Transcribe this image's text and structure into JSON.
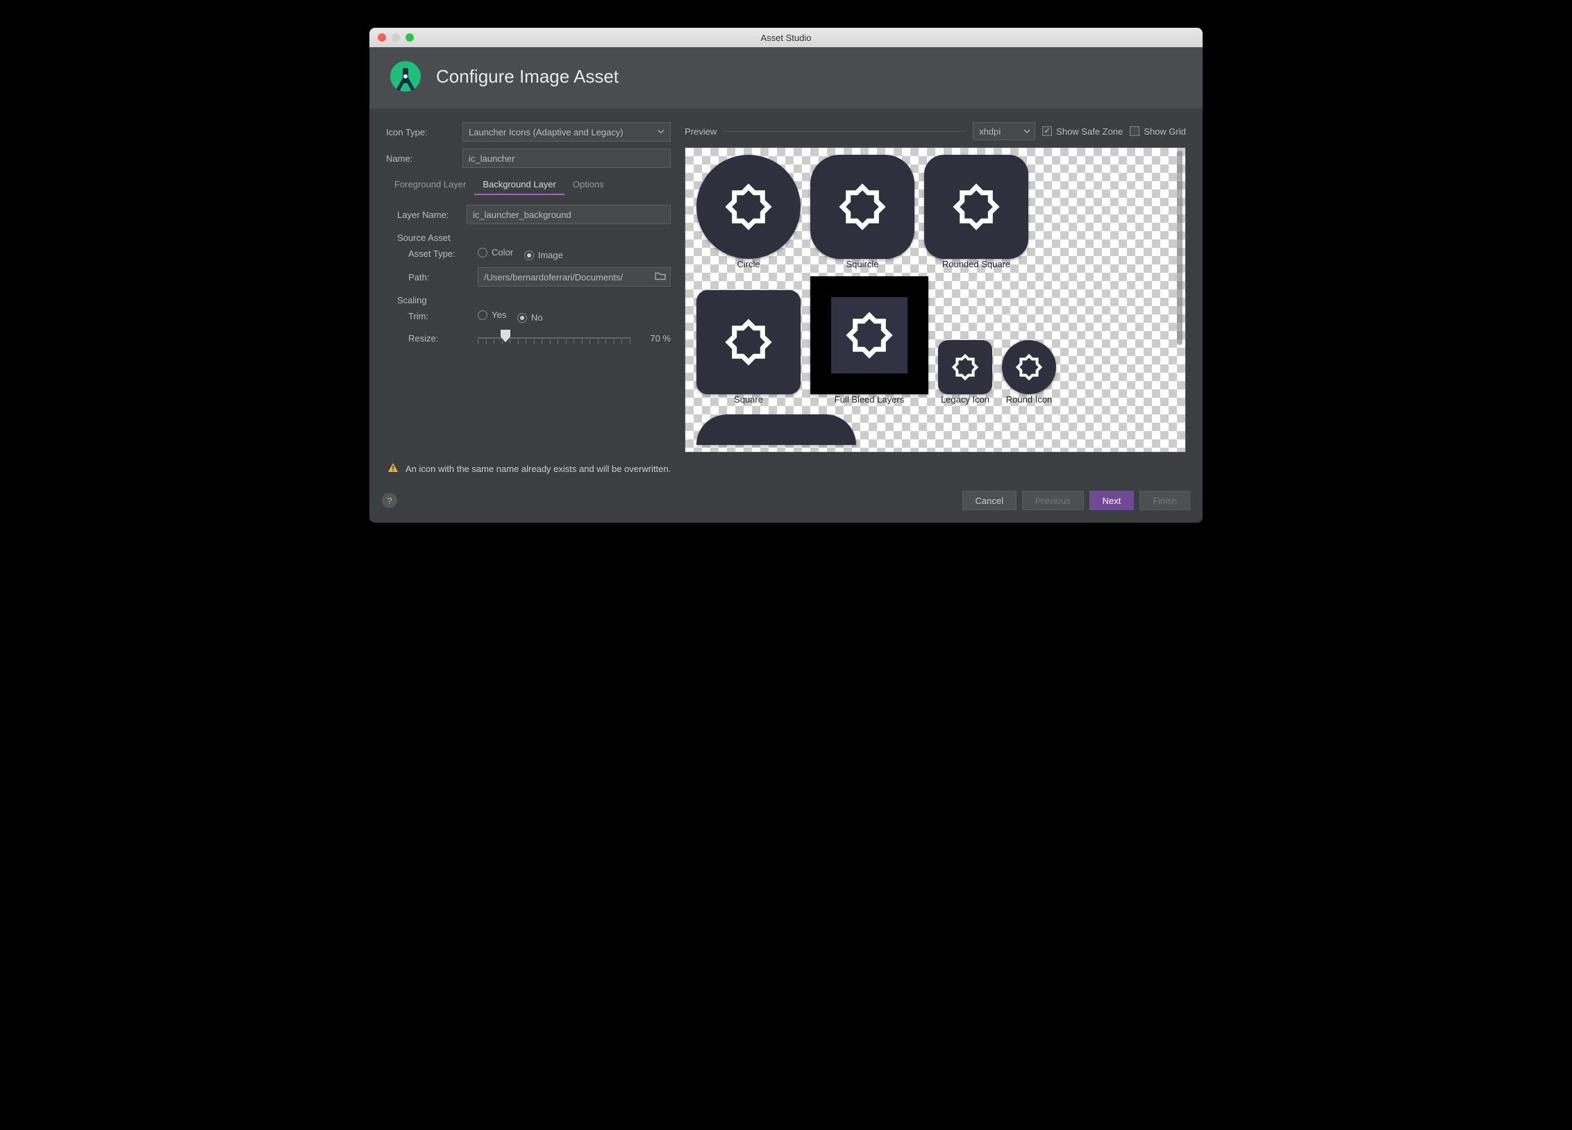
{
  "window": {
    "title": "Asset Studio"
  },
  "header": {
    "title": "Configure Image Asset"
  },
  "form": {
    "icon_type_label": "Icon Type:",
    "icon_type_value": "Launcher Icons (Adaptive and Legacy)",
    "name_label": "Name:",
    "name_value": "ic_launcher",
    "tabs": {
      "foreground": "Foreground Layer",
      "background": "Background Layer",
      "options": "Options"
    },
    "layer_name_label": "Layer Name:",
    "layer_name_value": "ic_launcher_background",
    "source_asset_label": "Source Asset",
    "asset_type_label": "Asset Type:",
    "asset_type_options": {
      "color": "Color",
      "image": "Image"
    },
    "path_label": "Path:",
    "path_value": "/Users/bernardoferrari/Documents/",
    "scaling_label": "Scaling",
    "trim_label": "Trim:",
    "trim_options": {
      "yes": "Yes",
      "no": "No"
    },
    "resize_label": "Resize:",
    "resize_value": "70 %"
  },
  "preview": {
    "label": "Preview",
    "density": "xhdpi",
    "show_safe_zone": "Show Safe Zone",
    "show_grid": "Show Grid",
    "captions": {
      "circle": "Circle",
      "squircle": "Squircle",
      "rounded": "Rounded Square",
      "square": "Square",
      "full_bleed": "Full Bleed Layers",
      "legacy": "Legacy Icon",
      "round": "Round Icon"
    }
  },
  "warning": "An icon with the same name already exists and will be overwritten.",
  "footer": {
    "cancel": "Cancel",
    "previous": "Previous",
    "next": "Next",
    "finish": "Finish"
  }
}
